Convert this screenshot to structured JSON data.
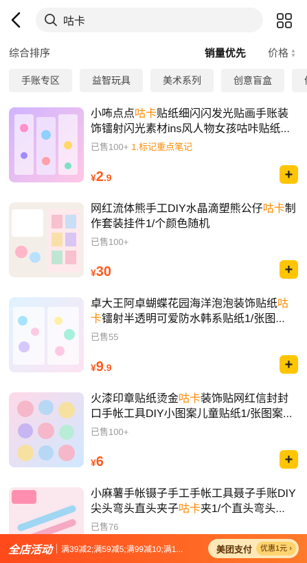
{
  "header": {
    "search_query": "咕卡"
  },
  "sort": {
    "default_label": "综合排序",
    "sales_label": "销量优先",
    "price_label": "价格"
  },
  "chips": [
    "手账专区",
    "益智玩具",
    "美术系列",
    "创意盲盒",
    "便"
  ],
  "items": [
    {
      "title_pre": "小咘点点",
      "title_hl": "咕卡",
      "title_post": "贴纸细闪闪发光贴画手账装饰镭射闪光素材ins风人物女孩咕咔贴纸...",
      "sold": "已售100+",
      "tag": "1.标记重点笔记",
      "price_currency": "¥",
      "price_int": "2",
      "price_dec": ".9"
    },
    {
      "title_pre": "网红流体熊手工DIY水晶滴塑熊公仔",
      "title_hl": "咕卡",
      "title_post": "制作套装挂件1/个颜色随机",
      "sold": "已售100+",
      "tag": "",
      "price_currency": "¥",
      "price_int": "30",
      "price_dec": ""
    },
    {
      "title_pre": "卓大王阿卓蝴蝶花园海洋泡泡装饰贴纸",
      "title_hl": "咕卡",
      "title_post": "镭射半透明可爱防水韩系贴纸1/张图...",
      "sold": "已售55",
      "tag": "",
      "price_currency": "¥",
      "price_int": "9",
      "price_dec": ".9"
    },
    {
      "title_pre": "火漆印章贴纸烫金",
      "title_hl": "咕卡",
      "title_post": "装饰贴网红信封封口手帐工具DIY小图案儿童贴纸1/张图案...",
      "sold": "已售100+",
      "tag": "",
      "price_currency": "¥",
      "price_int": "6",
      "price_dec": ""
    },
    {
      "title_pre": "小麻薯手帐镊子手工手帐工具聂子手账DIY尖头弯头直头夹子",
      "title_hl": "咕卡",
      "title_post": "夹1/个直头弯头...",
      "sold": "已售76",
      "tag": "",
      "price_currency": "¥",
      "price_int": "",
      "price_dec": ""
    }
  ],
  "promo": {
    "label": "全店活动",
    "rules": "满39减2;满59减5;满99减10;满1...",
    "pay_label": "美团支付",
    "discount": "优惠1元 ›"
  },
  "colors": {
    "accent": "#ff8a00",
    "price": "#ff5a1e",
    "add_button": "#ffc500",
    "promo_bg": "#ff4a1c"
  }
}
